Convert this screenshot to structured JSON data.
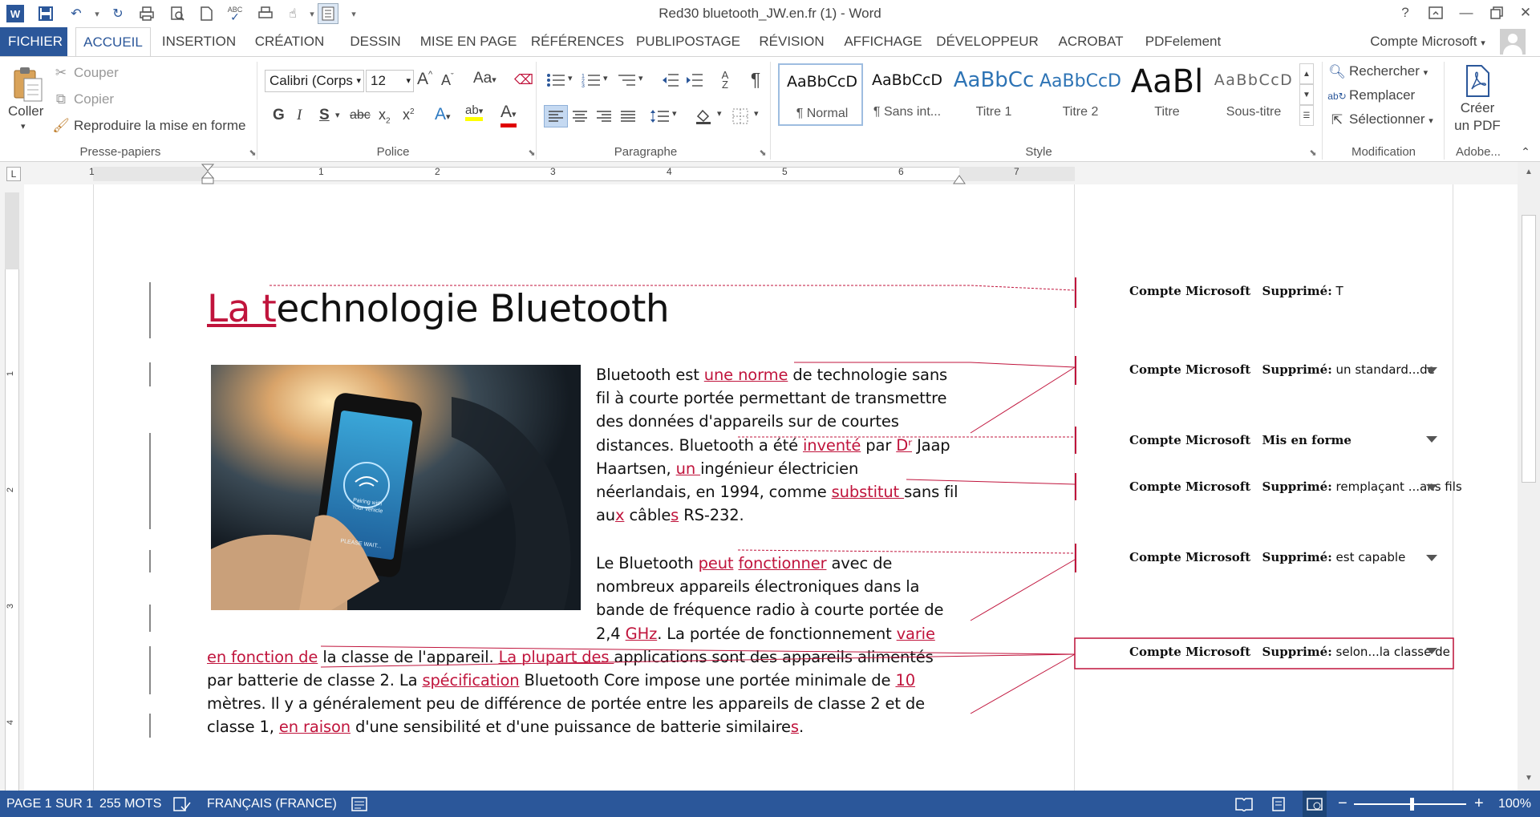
{
  "window": {
    "title": "Red30 bluetooth_JW.en.fr (1) - Word",
    "help": "?"
  },
  "tabs": [
    {
      "label": "FICHIER"
    },
    {
      "label": "ACCUEIL"
    },
    {
      "label": "INSERTION"
    },
    {
      "label": "CRÉATION"
    },
    {
      "label": "DESSIN"
    },
    {
      "label": "MISE EN PAGE"
    },
    {
      "label": "RÉFÉRENCES"
    },
    {
      "label": "PUBLIPOSTAGE"
    },
    {
      "label": "RÉVISION"
    },
    {
      "label": "AFFICHAGE"
    },
    {
      "label": "DÉVELOPPEUR"
    },
    {
      "label": "ACROBAT"
    },
    {
      "label": "PDFelement"
    }
  ],
  "account": {
    "label": "Compte Microsoft"
  },
  "clipboard": {
    "paste": "Coller",
    "cut": "Couper",
    "copy": "Copier",
    "format_painter": "Reproduire la mise en forme",
    "group": "Presse-papiers"
  },
  "font": {
    "name": "Calibri (Corps",
    "size": "12",
    "aa": "Aa",
    "bold": "G",
    "italic": "I",
    "underline": "S",
    "strike": "abc",
    "group": "Police"
  },
  "paragraph": {
    "group": "Paragraphe"
  },
  "styles": {
    "items": [
      {
        "preview": "AaBbCcD",
        "label": "¶ Normal"
      },
      {
        "preview": "AaBbCcD",
        "label": "¶ Sans int..."
      },
      {
        "preview": "AaBbCc",
        "label": "Titre 1"
      },
      {
        "preview": "AaBbCcD",
        "label": "Titre 2"
      },
      {
        "preview": "AaBl",
        "label": "Titre"
      },
      {
        "preview": "AaBbCcD",
        "label": "Sous-titre"
      }
    ],
    "group": "Style"
  },
  "editing": {
    "find": "Rechercher",
    "replace": "Remplacer",
    "select": "Sélectionner",
    "group": "Modification"
  },
  "adobe": {
    "line1": "Créer",
    "line2": "un PDF",
    "group": "Adobe..."
  },
  "ruler": {
    "numbers": [
      "1",
      "1",
      "2",
      "3",
      "4",
      "5",
      "6",
      "7"
    ]
  },
  "vruler": {
    "numbers": [
      "1",
      "2",
      "3",
      "4"
    ]
  },
  "document": {
    "title_ins": "La t",
    "title_rest": "echnologie Bluetooth",
    "image_alt": "Pairing with Your Vehicle",
    "image_text1": "Pairing with",
    "image_text2": "Your Vehicle",
    "image_text3": "PLEASE WAIT...",
    "p1": [
      [
        {
          "t": "Bluetooth est "
        },
        {
          "t": "une norme",
          "ins": true
        },
        {
          "t": " de technologie sans"
        }
      ],
      [
        {
          "t": "fil à courte portée permettant de transmettre"
        }
      ],
      [
        {
          "t": "des données d'appareils sur de courtes"
        }
      ],
      [
        {
          "t": "distances. Bluetooth a été "
        },
        {
          "t": "inventé",
          "ins": true
        },
        {
          "t": " par "
        },
        {
          "t": "Dʳ",
          "ins": true
        },
        {
          "t": " Jaap"
        }
      ],
      [
        {
          "t": "Haartsen, "
        },
        {
          "t": "un ",
          "ins": true
        },
        {
          "t": "ingénieur électricien"
        }
      ],
      [
        {
          "t": "néerlandais, en 1994, comme "
        },
        {
          "t": "substitut ",
          "ins": true
        },
        {
          "t": "sans fil"
        }
      ],
      [
        {
          "t": "au"
        },
        {
          "t": "x",
          "ins": true
        },
        {
          "t": " câble"
        },
        {
          "t": "s",
          "ins": true
        },
        {
          "t": " RS-232."
        }
      ]
    ],
    "p2": [
      [
        {
          "t": "Le Bluetooth "
        },
        {
          "t": "peut",
          "ins": true
        },
        {
          "t": " "
        },
        {
          "t": "fonctionner",
          "ins": true
        },
        {
          "t": " avec de"
        }
      ],
      [
        {
          "t": "nombreux appareils électroniques dans la"
        }
      ],
      [
        {
          "t": "bande de fréquence radio à courte portée de"
        }
      ],
      [
        {
          "t": "2,4 "
        },
        {
          "t": "GHz",
          "ins": true
        },
        {
          "t": ". La portée de fonctionnement "
        },
        {
          "t": "varie",
          "ins": true
        }
      ],
      [
        {
          "t": "en fonction de",
          "ins": true
        },
        {
          "t": " la classe de l'appareil. "
        },
        {
          "t": "La plupart des ",
          "ins": true
        },
        {
          "t": "applications sont des appareils alimentés"
        }
      ],
      [
        {
          "t": "par batterie de classe 2. La "
        },
        {
          "t": "spécification",
          "ins": true
        },
        {
          "t": " Bluetooth Core impose une portée minimale de "
        },
        {
          "t": "10",
          "ins": true
        }
      ],
      [
        {
          "t": "mètres. Il y a généralement peu de différence de portée entre les appareils de classe 2 et de"
        }
      ],
      [
        {
          "t": "classe 1, "
        },
        {
          "t": "en raison",
          "ins": true
        },
        {
          "t": " d'une sensibilité et d'une puissance de batterie similaire"
        },
        {
          "t": "s",
          "ins": true
        },
        {
          "t": "."
        }
      ]
    ]
  },
  "comments": [
    {
      "author": "Compte Microsoft",
      "action": "Supprimé:",
      "text": "T"
    },
    {
      "author": "Compte Microsoft",
      "action": "Supprimé:",
      "text": "un standard...de"
    },
    {
      "author": "Compte Microsoft",
      "action": "Mis en forme",
      "text": ""
    },
    {
      "author": "Compte Microsoft",
      "action": "Supprimé:",
      "text": "remplaçant ...ans fils"
    },
    {
      "author": "Compte Microsoft",
      "action": "Supprimé:",
      "text": "est capable"
    },
    {
      "author": "Compte Microsoft",
      "action": "Supprimé:",
      "text": "selon...la classe de"
    }
  ],
  "status": {
    "page": "PAGE 1 SUR 1",
    "words": "255 MOTS",
    "language": "FRANÇAIS (FRANCE)",
    "zoom": "100%",
    "zoom_level_percent": 100
  },
  "colors": {
    "accent": "#2b579a",
    "revision": "#c0143c"
  }
}
